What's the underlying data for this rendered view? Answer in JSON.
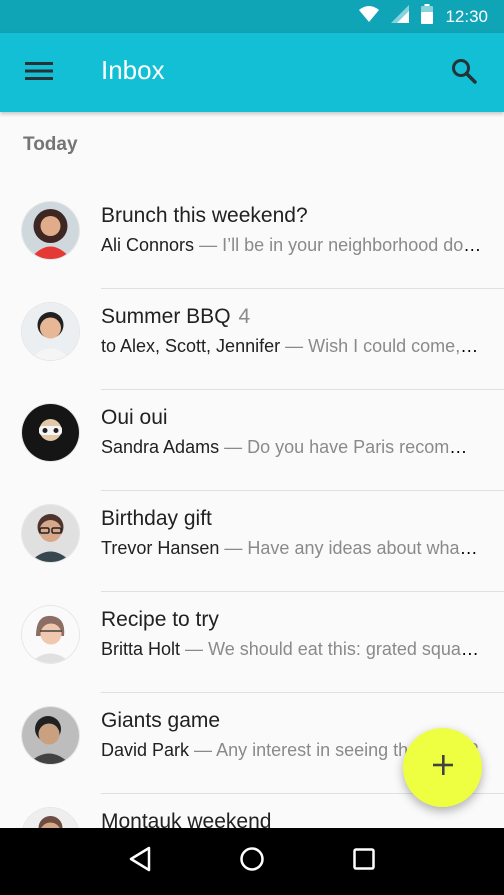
{
  "status_bar": {
    "time": "12:30",
    "icons": [
      "wifi-icon",
      "signal-icon",
      "battery-icon"
    ]
  },
  "app_bar": {
    "title": "Inbox",
    "menu_icon": "menu-icon",
    "search_icon": "search-icon",
    "color": "#12bfd4"
  },
  "section": {
    "label": "Today"
  },
  "mails": [
    {
      "subject": "Brunch this weekend?",
      "count": "",
      "sender": "Ali Connors",
      "preview": "I’ll be in your neighborhood doing errands this weekend."
    },
    {
      "subject": "Summer BBQ",
      "count": "4",
      "sender": "to Alex, Scott, Jennifer",
      "preview": "Wish I could come, but I’m out of town."
    },
    {
      "subject": "Oui oui",
      "count": "",
      "sender": "Sandra Adams",
      "preview": "Do you have Paris recommendations?"
    },
    {
      "subject": "Birthday gift",
      "count": "",
      "sender": "Trevor Hansen",
      "preview": "Have any ideas about what we should get?"
    },
    {
      "subject": "Recipe to try",
      "count": "",
      "sender": "Britta Holt",
      "preview": "We should eat this: grated squash."
    },
    {
      "subject": "Giants game",
      "count": "",
      "sender": "David Park",
      "preview": "Any interest in seeing the game?"
    },
    {
      "subject": "Montauk weekend",
      "count": "",
      "sender": "",
      "preview": ""
    }
  ],
  "fab": {
    "icon": "add-icon",
    "color": "#eeff41"
  },
  "nav_bar": {
    "icons": [
      "back-icon",
      "home-icon",
      "recents-icon"
    ]
  },
  "dash": "—"
}
